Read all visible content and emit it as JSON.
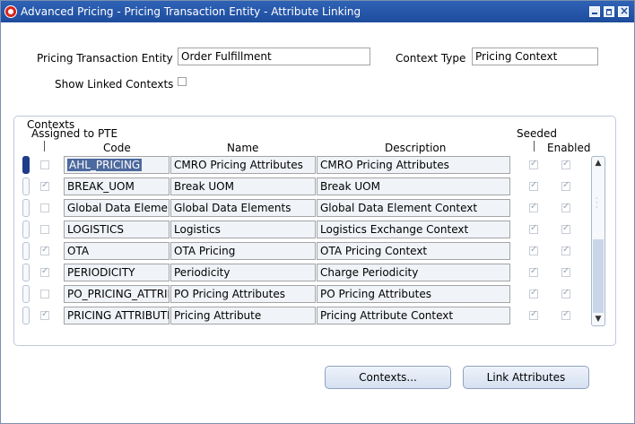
{
  "window": {
    "title": "Advanced Pricing - Pricing Transaction Entity - Attribute Linking",
    "icon": "oracle-logo-icon"
  },
  "header": {
    "pte_label": "Pricing Transaction Entity",
    "pte_value": "Order Fulfillment",
    "context_type_label": "Context Type",
    "context_type_value": "Pricing Context",
    "show_linked_label": "Show Linked Contexts",
    "show_linked_checked": false
  },
  "contexts": {
    "group_label": "Contexts",
    "columns": {
      "assigned": "Assigned to PTE",
      "code": "Code",
      "name": "Name",
      "description": "Description",
      "seeded": "Seeded",
      "enabled": "Enabled"
    },
    "rows": [
      {
        "assigned": false,
        "code": "AHL_PRICING",
        "name": "CMRO Pricing Attributes",
        "description": "CMRO Pricing Attributes",
        "seeded": true,
        "enabled": true
      },
      {
        "assigned": true,
        "code": "BREAK_UOM",
        "name": "Break UOM",
        "description": "Break UOM",
        "seeded": true,
        "enabled": true
      },
      {
        "assigned": false,
        "code": "Global Data Element",
        "name": "Global Data Elements",
        "description": "Global Data Element Context",
        "seeded": true,
        "enabled": true
      },
      {
        "assigned": false,
        "code": "LOGISTICS",
        "name": "Logistics",
        "description": "Logistics Exchange Context",
        "seeded": true,
        "enabled": true
      },
      {
        "assigned": true,
        "code": "OTA",
        "name": "OTA Pricing",
        "description": "OTA Pricing Context",
        "seeded": true,
        "enabled": true
      },
      {
        "assigned": true,
        "code": "PERIODICITY",
        "name": "Periodicity",
        "description": "Charge Periodicity",
        "seeded": true,
        "enabled": true
      },
      {
        "assigned": false,
        "code": "PO_PRICING_ATTRIBUTE",
        "name": "PO Pricing Attributes",
        "description": "PO Pricing Attributes",
        "seeded": true,
        "enabled": true
      },
      {
        "assigned": true,
        "code": "PRICING ATTRIBUTE",
        "name": "Pricing Attribute",
        "description": "Pricing Attribute Context",
        "seeded": true,
        "enabled": true
      }
    ]
  },
  "buttons": {
    "contexts": "Contexts...",
    "link_attributes": "Link Attributes"
  },
  "colors": {
    "titlebar": "#1d4c9c",
    "selection": "#4d6a9e"
  }
}
